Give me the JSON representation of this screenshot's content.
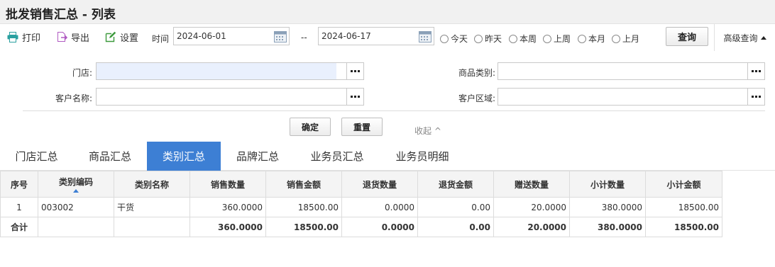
{
  "page": {
    "title": "批发销售汇总 - 列表"
  },
  "toolbar": {
    "print_label": "打印",
    "export_label": "导出",
    "settings_label": "设置",
    "time_label": "时间",
    "date_from": "2024-06-01",
    "date_sep": "--",
    "date_to": "2024-06-17",
    "quick_ranges": [
      "今天",
      "昨天",
      "本周",
      "上周",
      "本月",
      "上月"
    ],
    "query_label": "查询",
    "advanced_label": "高级查询"
  },
  "filters": {
    "store_label": "门店:",
    "category_label": "商品类别:",
    "customer_label": "客户名称:",
    "region_label": "客户区域:",
    "confirm_label": "确定",
    "reset_label": "重置",
    "collapse_label": "收起 ^"
  },
  "tabs": [
    "门店汇总",
    "商品汇总",
    "类别汇总",
    "品牌汇总",
    "业务员汇总",
    "业务员明细"
  ],
  "active_tab_index": 2,
  "table": {
    "headers": [
      "序号",
      "类别编码",
      "类别名称",
      "销售数量",
      "销售金额",
      "退货数量",
      "退货金额",
      "赠送数量",
      "小计数量",
      "小计金额"
    ],
    "rows": [
      [
        "1",
        "003002",
        "干货",
        "360.0000",
        "18500.00",
        "0.0000",
        "0.00",
        "20.0000",
        "380.0000",
        "18500.00"
      ]
    ],
    "total": [
      "合计",
      "",
      "",
      "360.0000",
      "18500.00",
      "0.0000",
      "0.00",
      "20.0000",
      "380.0000",
      "18500.00"
    ]
  },
  "colors": {
    "accent": "#3d7fd4",
    "store_field_fill": "#e9f0fd"
  }
}
